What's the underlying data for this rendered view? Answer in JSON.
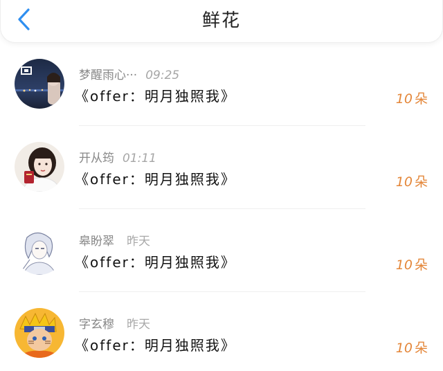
{
  "header": {
    "title": "鲜花",
    "back_icon": "chevron-left-icon",
    "accent_color": "#2f8ff0"
  },
  "items": [
    {
      "name": "梦醒雨心···",
      "time": "09:25",
      "gift": "《offer：明月独照我》",
      "amount": "10",
      "unit": "朵"
    },
    {
      "name": "开从筠",
      "time": "01:11",
      "gift": "《offer：明月独照我》",
      "amount": "10",
      "unit": "朵"
    },
    {
      "name": "皋盼翠",
      "time": "昨天",
      "gift": "《offer：明月独照我》",
      "amount": "10",
      "unit": "朵"
    },
    {
      "name": "字玄穆",
      "time": "昨天",
      "gift": "《offer：明月独照我》",
      "amount": "10",
      "unit": "朵"
    }
  ],
  "colors": {
    "amount": "#e4873a",
    "name": "#888888",
    "gift": "#111111"
  }
}
